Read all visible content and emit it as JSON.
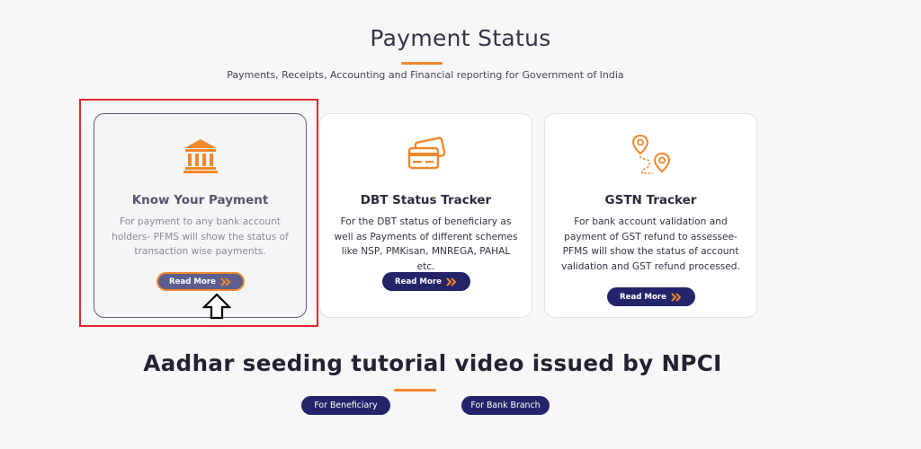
{
  "header": {
    "title": "Payment Status",
    "subtitle": "Payments, Receipts, Accounting and Financial reporting for Government of India"
  },
  "cards": [
    {
      "icon": "bank-icon",
      "title": "Know Your Payment",
      "description": "For payment to any bank account holders- PFMS will show the status of transaction wise payments.",
      "button_label": "Read More"
    },
    {
      "icon": "cards-icon",
      "title": "DBT Status Tracker",
      "description": "For the DBT status of beneficiary as well as Payments of different schemes like NSP, PMKisan, MNREGA, PAHAL etc.",
      "button_label": "Read More"
    },
    {
      "icon": "route-pin-icon",
      "title": "GSTN Tracker",
      "description": "For bank account validation and payment of GST refund to assessee- PFMS will show the status of account validation and GST refund processed.",
      "button_label": "Read More"
    }
  ],
  "aadhar": {
    "title": "Aadhar seeding tutorial video issued by NPCI",
    "beneficiary_label": "For Beneficiary",
    "bank_branch_label": "For Bank Branch"
  },
  "colors": {
    "accent": "#f0882c",
    "button": "#24246a",
    "highlight": "#e2262c"
  }
}
